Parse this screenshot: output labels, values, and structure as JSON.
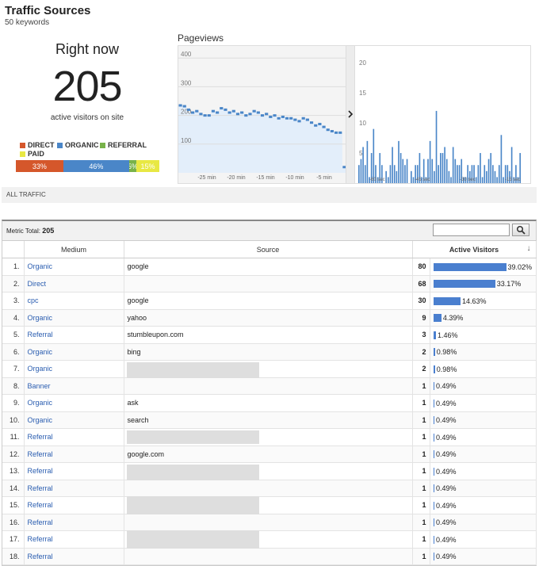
{
  "header": {
    "title": "Traffic Sources",
    "subtitle": "50 keywords"
  },
  "right_now": {
    "label": "Right now",
    "count": "205",
    "subtitle": "active visitors on site",
    "legend": [
      {
        "label": "DIRECT",
        "color": "#d5572b"
      },
      {
        "label": "ORGANIC",
        "color": "#4a86c8"
      },
      {
        "label": "REFERRAL",
        "color": "#78b24a"
      },
      {
        "label": "PAID",
        "color": "#e8e843"
      }
    ],
    "share_bar": [
      {
        "label": "33%",
        "fraction": 0.33,
        "color": "#d5572b"
      },
      {
        "label": "46%",
        "fraction": 0.46,
        "color": "#4a86c8"
      },
      {
        "label": "5%",
        "fraction": 0.05,
        "color": "#78b24a"
      },
      {
        "label": "15%",
        "fraction": 0.16,
        "color": "#e8e843"
      }
    ]
  },
  "pageviews": {
    "title": "Pageviews",
    "expand_icon": "chevron-right-icon"
  },
  "chart_data": [
    {
      "type": "line",
      "title": "Pageviews",
      "y_ticks": [
        "400",
        "300",
        "200",
        "100"
      ],
      "x_ticks": [
        "-25 min",
        "-20 min",
        "-15 min",
        "-10 min",
        "-5 min"
      ],
      "ylim": [
        0,
        420
      ],
      "series": [
        {
          "values": [
            235,
            232,
            220,
            210,
            215,
            205,
            200,
            200,
            215,
            210,
            225,
            220,
            210,
            215,
            205,
            210,
            200,
            205,
            215,
            210,
            200,
            205,
            195,
            200,
            190,
            195,
            190,
            190,
            185,
            180,
            190,
            185,
            175,
            165,
            170,
            160,
            150,
            145,
            140,
            140,
            20
          ]
        }
      ]
    },
    {
      "type": "bar",
      "y_ticks": [
        "20",
        "15",
        "10",
        "5"
      ],
      "x_ticks": [
        "-60 sec",
        "-45 sec",
        "-30 sec",
        "-15 sec"
      ],
      "ylim": [
        0,
        22
      ],
      "values": [
        3,
        4,
        6,
        3,
        7,
        1,
        5,
        9,
        3,
        1,
        5,
        3,
        0,
        2,
        1,
        3,
        6,
        3,
        2,
        7,
        5,
        4,
        3,
        4,
        0,
        2,
        1,
        3,
        3,
        5,
        1,
        4,
        1,
        4,
        7,
        4,
        2,
        12,
        3,
        5,
        5,
        6,
        4,
        2,
        1,
        6,
        4,
        3,
        3,
        4,
        1,
        1,
        3,
        2,
        3,
        3,
        1,
        3,
        5,
        1,
        3,
        2,
        4,
        5,
        3,
        2,
        1,
        3,
        8,
        1,
        3,
        3,
        2,
        6,
        1,
        3,
        1,
        5
      ]
    }
  ],
  "all_traffic": {
    "label": "ALL TRAFFIC"
  },
  "metric": {
    "label": "Metric Total:",
    "value": "205"
  },
  "search": {
    "placeholder": ""
  },
  "table": {
    "columns": [
      "Medium",
      "Source",
      "Active Visitors"
    ],
    "rows": [
      {
        "idx": "1.",
        "medium": "Organic",
        "source": "google",
        "count": "80",
        "pct": "39.02%",
        "frac": 0.3902
      },
      {
        "idx": "2.",
        "medium": "Direct",
        "source": "",
        "count": "68",
        "pct": "33.17%",
        "frac": 0.3317
      },
      {
        "idx": "3.",
        "medium": "cpc",
        "source": "google",
        "count": "30",
        "pct": "14.63%",
        "frac": 0.1463
      },
      {
        "idx": "4.",
        "medium": "Organic",
        "source": "yahoo",
        "count": "9",
        "pct": "4.39%",
        "frac": 0.0439
      },
      {
        "idx": "5.",
        "medium": "Referral",
        "source": "stumbleupon.com",
        "count": "3",
        "pct": "1.46%",
        "frac": 0.0146
      },
      {
        "idx": "6.",
        "medium": "Organic",
        "source": "bing",
        "count": "2",
        "pct": "0.98%",
        "frac": 0.0098
      },
      {
        "idx": "7.",
        "medium": "Organic",
        "source": "",
        "count": "2",
        "pct": "0.98%",
        "frac": 0.0098
      },
      {
        "idx": "8.",
        "medium": "Banner",
        "source": "",
        "count": "1",
        "pct": "0.49%",
        "frac": 0.0049
      },
      {
        "idx": "9.",
        "medium": "Organic",
        "source": "ask",
        "count": "1",
        "pct": "0.49%",
        "frac": 0.0049
      },
      {
        "idx": "10.",
        "medium": "Organic",
        "source": "search",
        "count": "1",
        "pct": "0.49%",
        "frac": 0.0049
      },
      {
        "idx": "11.",
        "medium": "Referral",
        "source": "",
        "count": "1",
        "pct": "0.49%",
        "frac": 0.0049
      },
      {
        "idx": "12.",
        "medium": "Referral",
        "source": "google.com",
        "count": "1",
        "pct": "0.49%",
        "frac": 0.0049
      },
      {
        "idx": "13.",
        "medium": "Referral",
        "source": "",
        "count": "1",
        "pct": "0.49%",
        "frac": 0.0049
      },
      {
        "idx": "14.",
        "medium": "Referral",
        "source": "",
        "count": "1",
        "pct": "0.49%",
        "frac": 0.0049
      },
      {
        "idx": "15.",
        "medium": "Referral",
        "source": "",
        "count": "1",
        "pct": "0.49%",
        "frac": 0.0049
      },
      {
        "idx": "16.",
        "medium": "Referral",
        "source": "",
        "count": "1",
        "pct": "0.49%",
        "frac": 0.0049
      },
      {
        "idx": "17.",
        "medium": "Referral",
        "source": "",
        "count": "1",
        "pct": "0.49%",
        "frac": 0.0049
      },
      {
        "idx": "18.",
        "medium": "Referral",
        "source": "",
        "count": "1",
        "pct": "0.49%",
        "frac": 0.0049
      }
    ]
  },
  "colors": {
    "link": "#2a5db0",
    "bar": "#4a7fcf"
  }
}
